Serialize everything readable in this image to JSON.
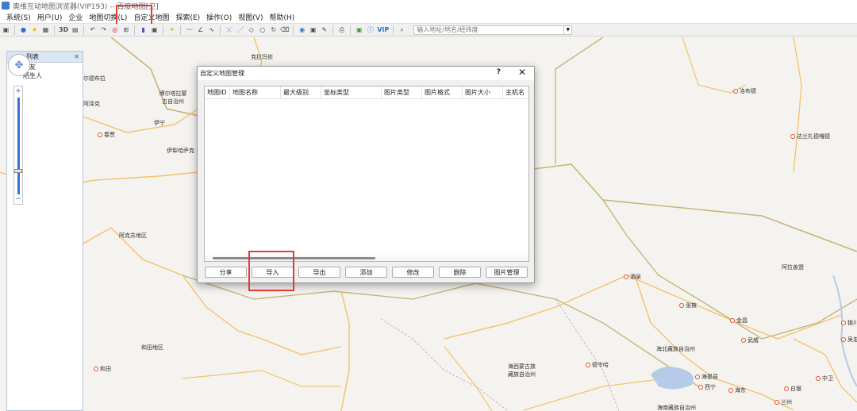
{
  "window": {
    "title": "奥维互动地图浏览器(VIP193) -- 百度地图[卫]"
  },
  "menu": {
    "items": [
      "系统(S)",
      "用户(U)",
      "企业",
      "地图切换(L)",
      "自定义地图",
      "探索(E)",
      "操作(O)",
      "视图(V)",
      "帮助(H)"
    ]
  },
  "toolbar": {
    "label_3d": "3D",
    "search_placeholder": "输入地址/地名/经纬度",
    "vip_label": "VIP"
  },
  "left_panel": {
    "title": "列表",
    "rows": [
      "好友",
      "陌生人"
    ]
  },
  "dialog": {
    "title": "自定义地图管理",
    "help": "?",
    "close": "✕",
    "columns": [
      "地图ID",
      "地图名称",
      "最大级别",
      "坐标类型",
      "图片类型",
      "图片格式",
      "图片大小",
      "主机名"
    ],
    "buttons": [
      "分享",
      "导入",
      "导出",
      "添加",
      "修改",
      "删除",
      "图片管理"
    ]
  },
  "map_places": [
    "克拉玛依",
    "尔德布拉",
    "博尔塔拉蒙古自治州",
    "阿泽克",
    "伊宁",
    "春贾",
    "伊犁哈萨克",
    "阿克苏地区",
    "和田地区",
    "和田",
    "洛布德",
    "达兰扎德嘎德",
    "阿拉善盟",
    "酒泉",
    "张掖",
    "金昌",
    "武威",
    "海北藏族自治州",
    "海西蒙古族藏族自治州",
    "德令哈",
    "海晏县",
    "西宁",
    "海东",
    "白银",
    "兰州",
    "中卫",
    "银川",
    "吴忠",
    "海南藏族自治州"
  ],
  "colors": {
    "highlight": "#e53935",
    "zoom_track": "#3a6fd0",
    "map_bg": "#f5f3ef",
    "road": "#f3c26b",
    "border": "#c8b47a"
  }
}
